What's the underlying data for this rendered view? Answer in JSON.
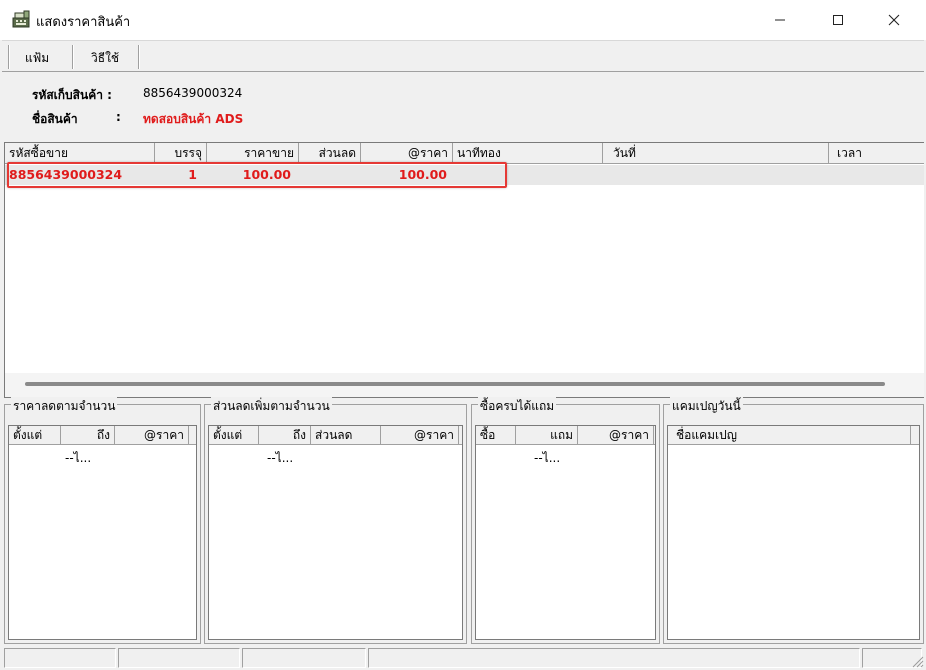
{
  "window": {
    "title": "แสดงราคาสินค้า",
    "minimize_glyph": "—",
    "maximize_glyph": "☐",
    "close_glyph": "✕",
    "icon": "cash-register-icon"
  },
  "menu": {
    "items": [
      {
        "label": "แฟ้ม"
      },
      {
        "label": "วิธีใช้"
      }
    ]
  },
  "product": {
    "code_label": "รหัสเก็บสินค้า :",
    "code_value": "8856439000324",
    "name_label": "ชื่อสินค้า",
    "name_colon": ":",
    "name_value": "ทดสอบสินค้า ADS",
    "name_color": "#e01b1b"
  },
  "price_table": {
    "columns": [
      "รหัสซื้อขาย",
      "บรรจุ",
      "ราคาขาย",
      "ส่วนลด",
      "@ราคา",
      "นาทีทอง",
      "วันที่",
      "เวลา"
    ],
    "rows": [
      {
        "code": "8856439000324",
        "pack": "1",
        "price": "100.00",
        "discount": "",
        "unit_price": "100.00",
        "golden_minute": "",
        "date": "",
        "time": ""
      }
    ],
    "row_color": "#e01b1b",
    "highlight_color": "#e53935"
  },
  "panels": {
    "qty_price": {
      "title": "ราคาลดตามจำนวน",
      "columns": [
        "ตั้งแต่",
        "ถึง",
        "@ราคา"
      ],
      "empty_text": "--ไ..."
    },
    "qty_discount": {
      "title": "ส่วนลดเพิ่มตามจำนวน",
      "columns": [
        "ตั้งแต่",
        "ถึง",
        "ส่วนลด",
        "@ราคา"
      ],
      "empty_text": "--ไ..."
    },
    "buy_get": {
      "title": "ซื้อครบได้แถม",
      "columns": [
        "ซื้อ",
        "แถม",
        "@ราคา"
      ],
      "empty_text": "--ไ..."
    },
    "campaign": {
      "title": "แคมเปญวันนี้",
      "columns": [
        "ชื่อแคมเปญ"
      ]
    }
  }
}
